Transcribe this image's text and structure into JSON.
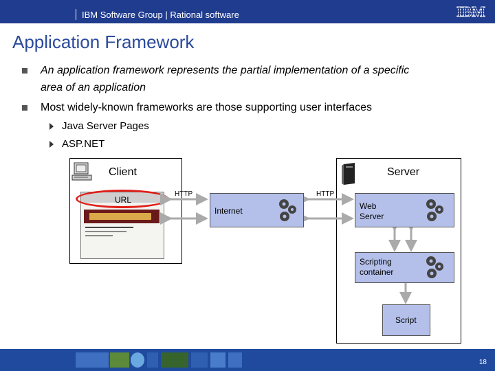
{
  "header": {
    "text": "IBM Software Group | Rational software",
    "logo": "IBM"
  },
  "slide": {
    "title": "Application Framework",
    "bullets": [
      {
        "line1": "An application framework represents the partial implementation of a specific",
        "line2": "area of an application"
      },
      {
        "text": "Most widely-known frameworks are those supporting user interfaces"
      }
    ],
    "subbullets": [
      "Java Server Pages",
      "ASP.NET"
    ]
  },
  "diagram": {
    "client_label": "Client",
    "server_label": "Server",
    "url_label": "URL",
    "http_left": "HTTP",
    "http_right": "HTTP",
    "internet_label": "Internet",
    "web_server_label": [
      "Web",
      "Server"
    ],
    "scripting_label": [
      "Scripting",
      "container"
    ],
    "script_label": "Script",
    "highlight_color": "#e0201a",
    "node_color": "#b4c0ea"
  },
  "footer": {
    "page_number": "18"
  }
}
